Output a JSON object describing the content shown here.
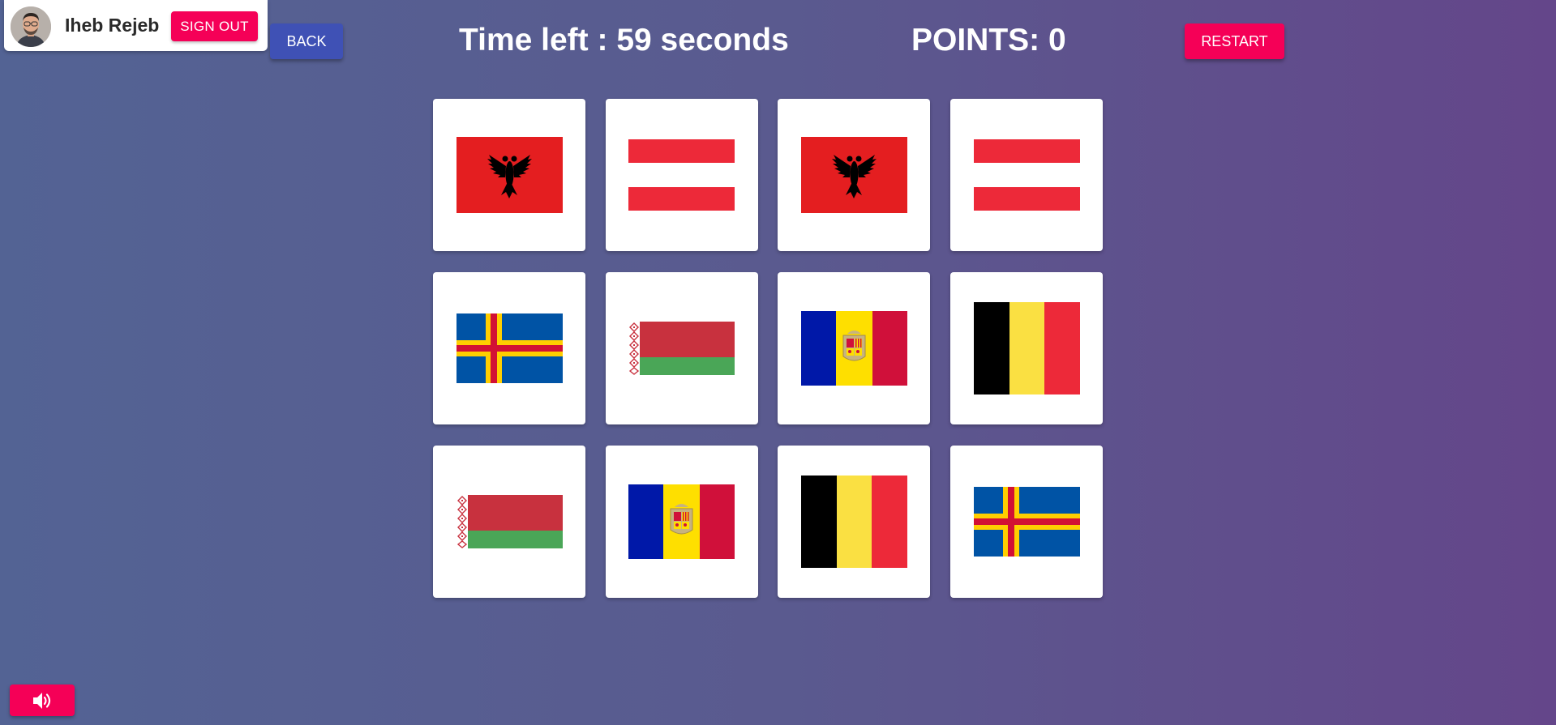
{
  "user": {
    "name": "Iheb Rejeb",
    "sign_out_label": "SIGN OUT"
  },
  "nav": {
    "back_label": "BACK",
    "restart_label": "RESTART"
  },
  "game": {
    "timer_text": "Time left : 59 seconds",
    "points_text": "POINTS: 0",
    "cards": [
      {
        "flag": "albania"
      },
      {
        "flag": "austria"
      },
      {
        "flag": "albania"
      },
      {
        "flag": "austria"
      },
      {
        "flag": "aland"
      },
      {
        "flag": "belarus"
      },
      {
        "flag": "andorra"
      },
      {
        "flag": "belgium"
      },
      {
        "flag": "belarus"
      },
      {
        "flag": "andorra"
      },
      {
        "flag": "belgium"
      },
      {
        "flag": "aland"
      }
    ]
  },
  "controls": {
    "sound_icon": "speaker-volume-icon"
  },
  "colors": {
    "accent": "#f50057",
    "primary": "#3f51b5",
    "card": "#ffffff"
  }
}
